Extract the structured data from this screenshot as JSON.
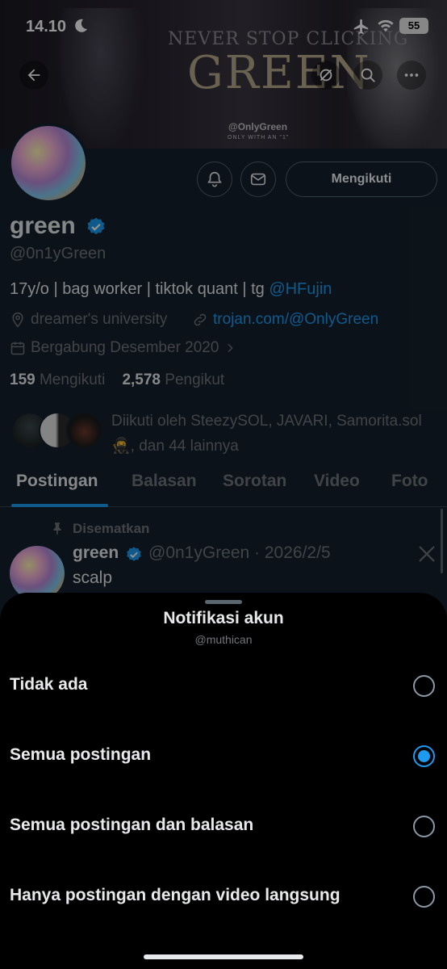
{
  "status_bar": {
    "time": "14.10",
    "battery": "55",
    "icons": [
      "moon-icon",
      "airplane-icon",
      "wifi-icon",
      "battery-icon"
    ]
  },
  "banner": {
    "line1": "NEVER STOP CLICKING",
    "line2": "GREEN",
    "handle": "@OnlyGreen",
    "tagline": "ONLY WITH AN \"1\""
  },
  "top_nav": {
    "icons": [
      "back-arrow-icon",
      "grok-icon",
      "search-icon",
      "more-icon"
    ]
  },
  "profile": {
    "display_name": "green",
    "handle": "@0n1yGreen",
    "bio_text": "17y/o | bag worker | tiktok quant | tg ",
    "bio_link": "@HFujin",
    "location": "dreamer's university",
    "website": "trojan.com/@OnlyGreen",
    "joined": "Bergabung Desember 2020",
    "following_count": "159",
    "following_label": "Mengikuti",
    "followers_count": "2,578",
    "followers_label": "Pengikut",
    "mutuals_text": "Diikuti oleh SteezySOL, JAVARI, Samorita.sol 🥷, dan 44 lainnya",
    "follow_button": "Mengikuti"
  },
  "tabs": [
    "Postingan",
    "Balasan",
    "Sorotan",
    "Video",
    "Foto"
  ],
  "pinned_post": {
    "pinned_label": "Disematkan",
    "author": "green",
    "handle_date": "@0n1yGreen · 2026/2/5",
    "text": "scalp"
  },
  "sheet": {
    "title": "Notifikasi akun",
    "subtitle": "@muthican",
    "options": [
      {
        "label": "Tidak ada",
        "selected": false
      },
      {
        "label": "Semua postingan",
        "selected": true
      },
      {
        "label": "Semua postingan dan balasan",
        "selected": false
      },
      {
        "label": "Hanya postingan dengan video langsung",
        "selected": false
      }
    ]
  },
  "colors": {
    "accent": "#1d9bf0",
    "background": "#15202b",
    "sheet": "#000000",
    "secondary_text": "#71767b"
  }
}
